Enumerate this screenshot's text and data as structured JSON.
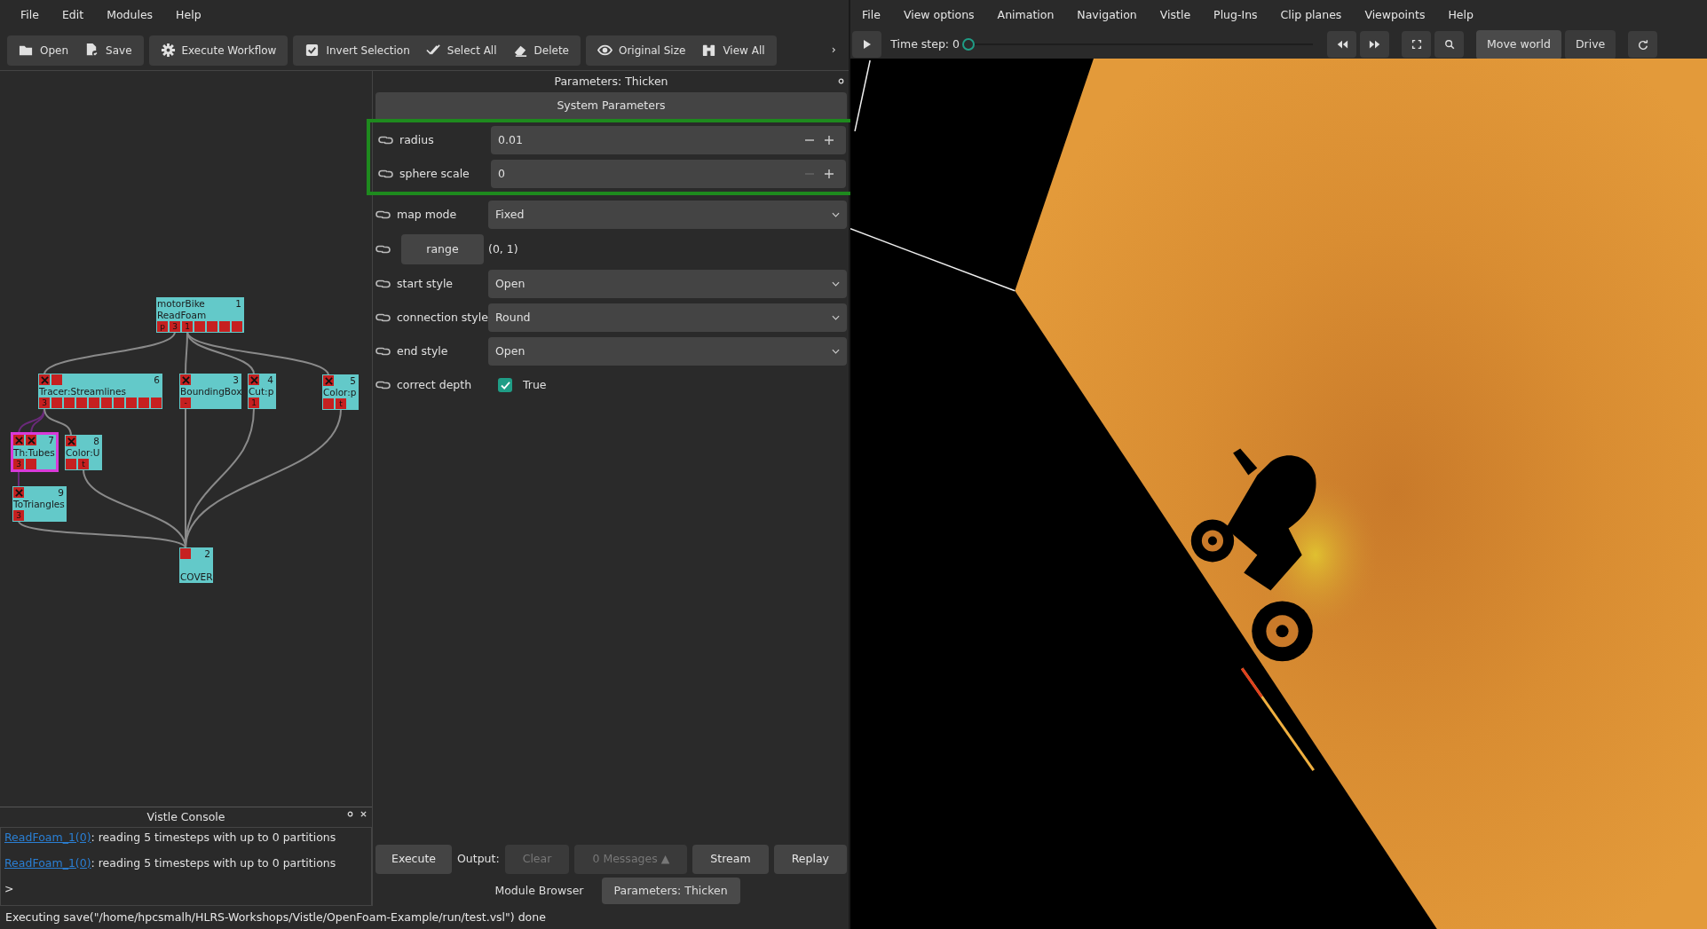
{
  "editor": {
    "menu": [
      "File",
      "Edit",
      "Modules",
      "Help"
    ],
    "toolbar": [
      {
        "buttons": [
          "Open",
          "Save"
        ]
      },
      {
        "buttons": [
          "Execute Workflow"
        ]
      },
      {
        "buttons": [
          "Invert Selection",
          "Select All",
          "Delete"
        ]
      },
      {
        "buttons": [
          "Original Size",
          "View All"
        ]
      }
    ],
    "toolbar_overflow": "›",
    "workflow": {
      "nodes": [
        {
          "lines": [
            "motorBike",
            "ReadFoam"
          ],
          "number": "1",
          "selected": false,
          "outputs": [
            {
              "kind": "labeled",
              "label": "p"
            },
            {
              "kind": "labeled",
              "label": "3"
            },
            {
              "kind": "labeled",
              "label": "1"
            },
            {
              "kind": "plain"
            },
            {
              "kind": "plain"
            },
            {
              "kind": "plain"
            },
            {
              "kind": "plain"
            }
          ]
        },
        {
          "lines": [
            "Tracer:Streamlines"
          ],
          "number": "6",
          "selected": false,
          "inputs": [
            {
              "kind": "connected"
            },
            {
              "kind": "plain"
            }
          ],
          "outputs": [
            {
              "kind": "labeled",
              "label": "3"
            },
            {
              "kind": "plain"
            },
            {
              "kind": "plain"
            },
            {
              "kind": "plain"
            },
            {
              "kind": "plain"
            },
            {
              "kind": "plain"
            },
            {
              "kind": "plain"
            },
            {
              "kind": "plain"
            },
            {
              "kind": "plain"
            },
            {
              "kind": "plain"
            }
          ]
        },
        {
          "lines": [
            "BoundingBox"
          ],
          "number": "3",
          "selected": false,
          "inputs": [
            {
              "kind": "connected"
            }
          ],
          "outputs": [
            {
              "kind": "labeled",
              "label": "-"
            }
          ]
        },
        {
          "lines": [
            "Cut:p"
          ],
          "number": "4",
          "selected": false,
          "inputs": [
            {
              "kind": "connected"
            }
          ],
          "outputs": [
            {
              "kind": "labeled",
              "label": "1"
            }
          ]
        },
        {
          "lines": [
            "Color:p"
          ],
          "number": "5",
          "selected": false,
          "inputs": [
            {
              "kind": "connected"
            }
          ],
          "outputs": [
            {
              "kind": "plain"
            },
            {
              "kind": "labeled",
              "label": "t"
            }
          ]
        },
        {
          "lines": [
            "Th:Tubes"
          ],
          "number": "7",
          "selected": true,
          "inputs": [
            {
              "kind": "connected"
            },
            {
              "kind": "connected"
            }
          ],
          "outputs": [
            {
              "kind": "labeled",
              "label": "3"
            },
            {
              "kind": "plain"
            }
          ]
        },
        {
          "lines": [
            "Color:U"
          ],
          "number": "8",
          "selected": false,
          "inputs": [
            {
              "kind": "connected"
            }
          ],
          "outputs": [
            {
              "kind": "plain"
            },
            {
              "kind": "labeled",
              "label": "t"
            }
          ]
        },
        {
          "lines": [
            "ToTriangles"
          ],
          "number": "9",
          "selected": false,
          "inputs": [
            {
              "kind": "connected"
            }
          ],
          "outputs": [
            {
              "kind": "labeled",
              "label": "3"
            }
          ]
        },
        {
          "lines": [
            "COVER"
          ],
          "number": "2",
          "selected": false,
          "inputs": [
            {
              "kind": "plain"
            }
          ]
        }
      ]
    },
    "console": {
      "title": "Vistle Console",
      "lines": [
        {
          "link": "ReadFoam_1(0)",
          "text": ": reading 5 timesteps with up to 0 partitions"
        },
        {
          "link": "ReadFoam_1(0)",
          "text": ": reading 5 timesteps with up to 0 partitions"
        }
      ],
      "prompt": ">"
    },
    "parameters": {
      "title": "Parameters: Thicken",
      "section": "System Parameters",
      "rows": [
        {
          "kind": "highlight",
          "rows": [
            {
              "kind": "number",
              "label": "radius",
              "value": "0.01",
              "minus_disabled": false
            },
            {
              "kind": "number",
              "label": "sphere scale",
              "value": "0",
              "minus_disabled": true
            }
          ]
        },
        {
          "kind": "select",
          "label": "map mode",
          "value": "Fixed"
        },
        {
          "kind": "button",
          "label": "range",
          "value": "(0, 1)"
        },
        {
          "kind": "select",
          "label": "start style",
          "value": "Open"
        },
        {
          "kind": "select",
          "label": "connection style",
          "value": "Round"
        },
        {
          "kind": "select",
          "label": "end style",
          "value": "Open"
        },
        {
          "kind": "checkbox",
          "label": "correct depth",
          "value": "True",
          "checked": true
        }
      ]
    },
    "actions": {
      "execute": "Execute",
      "output_label": "Output:",
      "buttons": [
        {
          "label": "Clear",
          "disabled": true
        },
        {
          "label": "0 Messages ▲",
          "disabled": true
        },
        {
          "label": "Stream",
          "disabled": false
        },
        {
          "label": "Replay",
          "disabled": false
        }
      ]
    },
    "tabs": [
      {
        "label": "Module Browser",
        "selected": false
      },
      {
        "label": "Parameters: Thicken",
        "selected": true
      }
    ],
    "status_bar": "Executing save(\"/home/hpcsmalh/HLRS-Workshops/Vistle/OpenFoam-Example/run/test.vsl\") done"
  },
  "viewer": {
    "menu": [
      "File",
      "View options",
      "Animation",
      "Navigation",
      "Vistle",
      "Plug-Ins",
      "Clip planes",
      "Viewpoints",
      "Help"
    ],
    "timestep": {
      "label": "Time step: 0",
      "level": 0
    },
    "modes": [
      {
        "label": "Move world",
        "selected": true
      },
      {
        "label": "Drive",
        "selected": false
      }
    ]
  }
}
